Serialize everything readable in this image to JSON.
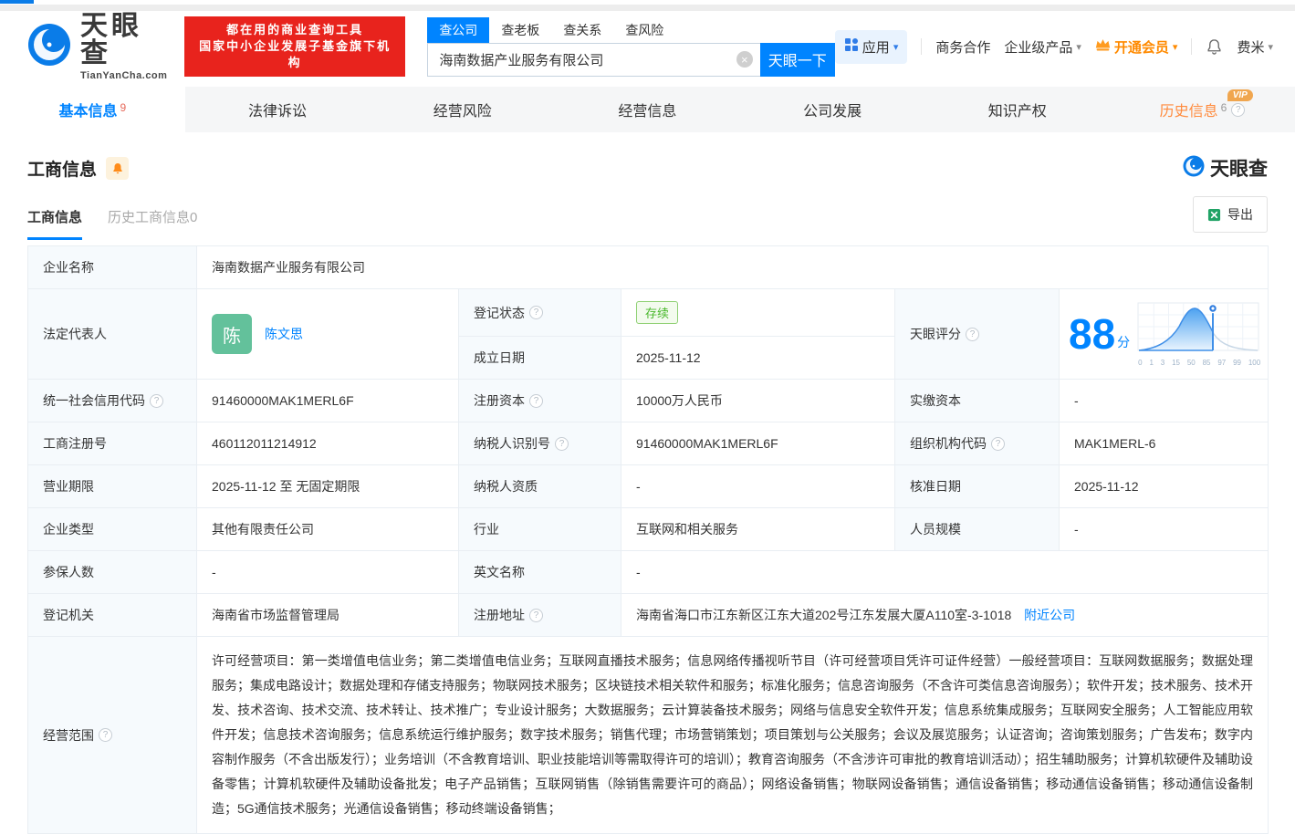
{
  "colors": {
    "accent": "#0084ff",
    "brand_red": "#e8231d",
    "vip_orange": "#ff8a00",
    "status_green": "#49b82c",
    "avatar_green": "#63c19b",
    "score_blue": "#0084ff"
  },
  "icons": {
    "caret": "▾",
    "help": "?",
    "clear": "×"
  },
  "header": {
    "logo_cn": "天眼查",
    "logo_en": "TianYanCha.com",
    "slogan_line1": "都在用的商业查询工具",
    "slogan_line2": "国家中小企业发展子基金旗下机构",
    "search_tabs": [
      "查公司",
      "查老板",
      "查关系",
      "查风险"
    ],
    "search_value": "海南数据产业服务有限公司",
    "search_button": "天眼一下",
    "apps_label": "应用",
    "biz_coop": "商务合作",
    "enterprise_products": "企业级产品",
    "vip_label": "开通会员",
    "username": "费米"
  },
  "page_tabs": [
    {
      "label": "基本信息",
      "count": "9"
    },
    {
      "label": "法律诉讼",
      "count": ""
    },
    {
      "label": "经营风险",
      "count": ""
    },
    {
      "label": "经营信息",
      "count": ""
    },
    {
      "label": "公司发展",
      "count": ""
    },
    {
      "label": "知识产权",
      "count": ""
    },
    {
      "label": "历史信息",
      "count": "6",
      "vip": "VIP"
    }
  ],
  "section": {
    "title": "工商信息",
    "watermark": "天眼查",
    "subtab_active": "工商信息",
    "subtab_history": "历史工商信息0",
    "export_label": "导出"
  },
  "info": {
    "company_name_label": "企业名称",
    "company_name": "海南数据产业服务有限公司",
    "legal_rep_label": "法定代表人",
    "legal_rep_avatar": "陈",
    "legal_rep_name": "陈文思",
    "reg_status_label": "登记状态",
    "reg_status": "存续",
    "establish_date_label": "成立日期",
    "establish_date": "2025-11-12",
    "score_label": "天眼评分",
    "credit_code_label": "统一社会信用代码",
    "credit_code": "91460000MAK1MERL6F",
    "reg_capital_label": "注册资本",
    "reg_capital": "10000万人民币",
    "paid_capital_label": "实缴资本",
    "paid_capital": "-",
    "reg_number_label": "工商注册号",
    "reg_number": "460112011214912",
    "taxpayer_id_label": "纳税人识别号",
    "taxpayer_id": "91460000MAK1MERL6F",
    "org_code_label": "组织机构代码",
    "org_code": "MAK1MERL-6",
    "business_term_label": "营业期限",
    "business_term": "2025-11-12 至 无固定期限",
    "taxpayer_quality_label": "纳税人资质",
    "taxpayer_quality": "-",
    "approval_date_label": "核准日期",
    "approval_date": "2025-11-12",
    "company_type_label": "企业类型",
    "company_type": "其他有限责任公司",
    "industry_label": "行业",
    "industry": "互联网和相关服务",
    "staff_size_label": "人员规模",
    "staff_size": "-",
    "insured_count_label": "参保人数",
    "insured_count": "-",
    "english_name_label": "英文名称",
    "english_name": "-",
    "reg_authority_label": "登记机关",
    "reg_authority": "海南省市场监督管理局",
    "reg_address_label": "注册地址",
    "reg_address": "海南省海口市江东新区江东大道202号江东发展大厦A110室-3-1018",
    "nearby_link": "附近公司",
    "business_scope_label": "经营范围",
    "business_scope": "许可经营项目：第一类增值电信业务；第二类增值电信业务；互联网直播技术服务；信息网络传播视听节目（许可经营项目凭许可证件经营）一般经营项目：互联网数据服务；数据处理服务；集成电路设计；数据处理和存储支持服务；物联网技术服务；区块链技术相关软件和服务；标准化服务；信息咨询服务（不含许可类信息咨询服务）；软件开发；技术服务、技术开发、技术咨询、技术交流、技术转让、技术推广；专业设计服务；大数据服务；云计算装备技术服务；网络与信息安全软件开发；信息系统集成服务；互联网安全服务；人工智能应用软件开发；信息技术咨询服务；信息系统运行维护服务；数字技术服务；销售代理；市场营销策划；项目策划与公关服务；会议及展览服务；认证咨询；咨询策划服务；广告发布；数字内容制作服务（不含出版发行）；业务培训（不含教育培训、职业技能培训等需取得许可的培训）；教育咨询服务（不含涉许可审批的教育培训活动）；招生辅助服务；计算机软硬件及辅助设备零售；计算机软硬件及辅助设备批发；电子产品销售；互联网销售（除销售需要许可的商品）；网络设备销售；物联网设备销售；通信设备销售；移动通信设备销售；移动通信设备制造；5G通信技术服务；光通信设备销售；移动终端设备销售；"
  },
  "score_chart": {
    "type": "area",
    "score": "88",
    "unit": "分",
    "x_ticks": [
      "0",
      "1",
      "3",
      "15",
      "50",
      "85",
      "97",
      "99",
      "100"
    ],
    "marker_tick": "85",
    "curve_color": "#3f8fe8",
    "fill_top": "#4da2f0",
    "fill_bottom": "#e9f4fe"
  }
}
